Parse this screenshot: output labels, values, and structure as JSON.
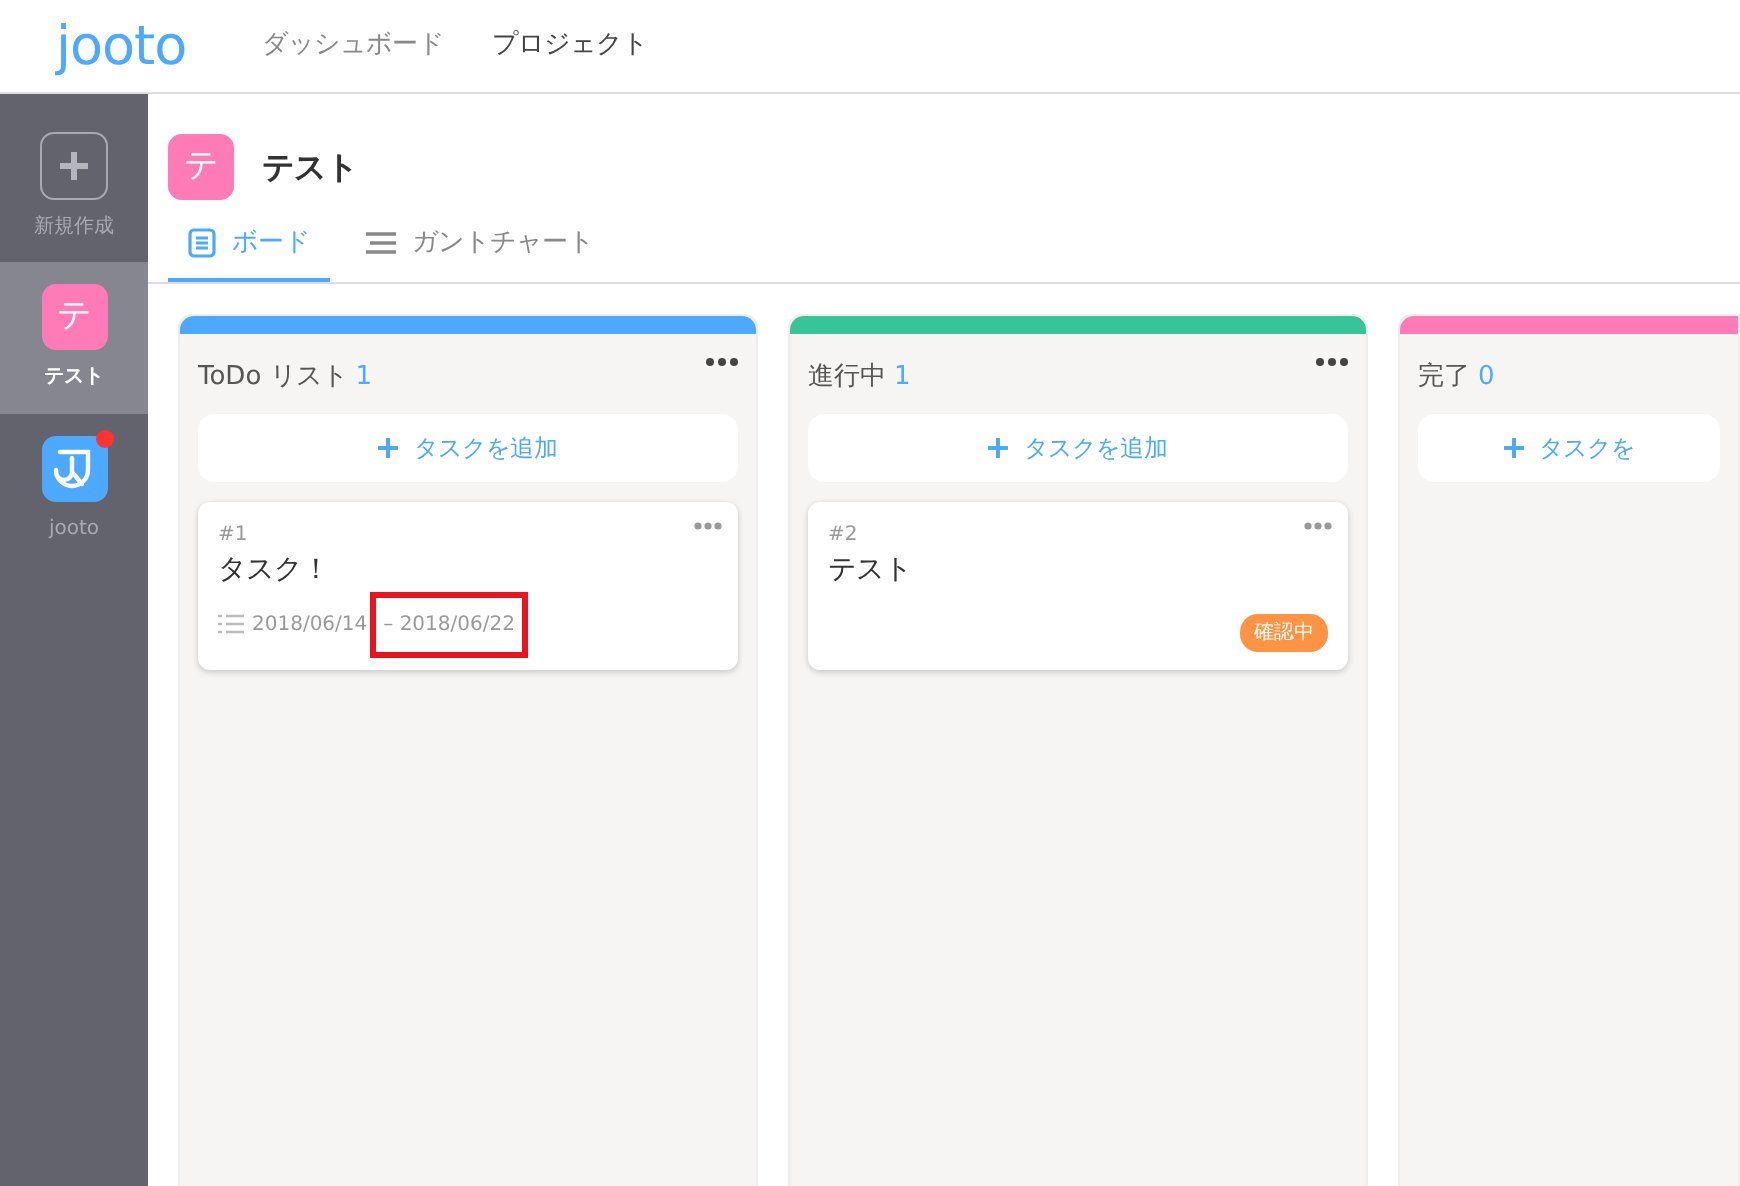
{
  "header": {
    "logo": "jooto",
    "nav": [
      {
        "label": "ダッシュボード",
        "selected": false
      },
      {
        "label": "プロジェクト",
        "selected": true
      }
    ]
  },
  "sidebar": {
    "items": [
      {
        "kind": "new",
        "label": "新規作成",
        "selected": false
      },
      {
        "kind": "project",
        "icon_text": "テ",
        "label": "テスト",
        "selected": true
      },
      {
        "kind": "app",
        "label": "jooto",
        "selected": false,
        "notification": true
      }
    ]
  },
  "project": {
    "icon_text": "テ",
    "title": "テスト"
  },
  "tabs": [
    {
      "kind": "board",
      "label": "ボード",
      "selected": true
    },
    {
      "kind": "gantt",
      "label": "ガントチャート",
      "selected": false
    }
  ],
  "columns": [
    {
      "title": "ToDo リスト",
      "count": "1",
      "color": "#4da9ff",
      "menu": true,
      "add_label": "タスクを追加",
      "tasks": [
        {
          "number": "#1",
          "title": "タスク！",
          "date_start": "2018/06/14",
          "date_end": "– 2018/06/22",
          "end_highlighted": true
        }
      ]
    },
    {
      "title": "進行中",
      "count": "1",
      "color": "#37c496",
      "menu": true,
      "add_label": "タスクを追加",
      "tasks": [
        {
          "number": "#2",
          "title": "テスト",
          "tag": "確認中"
        }
      ]
    },
    {
      "title": "完了",
      "count": "0",
      "color": "#ff7bb8",
      "menu": false,
      "add_label": "タスクを"
    }
  ]
}
